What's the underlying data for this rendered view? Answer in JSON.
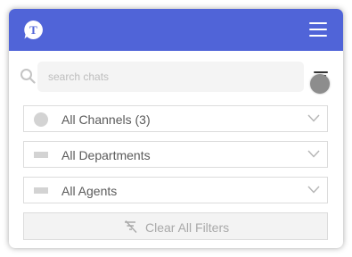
{
  "header": {
    "logo_letter": "T",
    "logo_icon": "chat-bubble-logo-icon",
    "menu_icon": "hamburger-menu-icon",
    "brand_color": "#5064d8"
  },
  "search": {
    "placeholder": "search chats",
    "value": "",
    "icon": "search-icon"
  },
  "filter_toggle": {
    "icon": "filter-lines-icon"
  },
  "filters": {
    "channels": {
      "label": "All Channels (3)",
      "icon": "circle-icon"
    },
    "departments": {
      "label": "All Departments",
      "icon": "rectangle-icon"
    },
    "agents": {
      "label": "All Agents",
      "icon": "rectangle-icon"
    }
  },
  "clear_filters": {
    "label": "Clear All Filters",
    "icon": "filter-off-icon"
  }
}
